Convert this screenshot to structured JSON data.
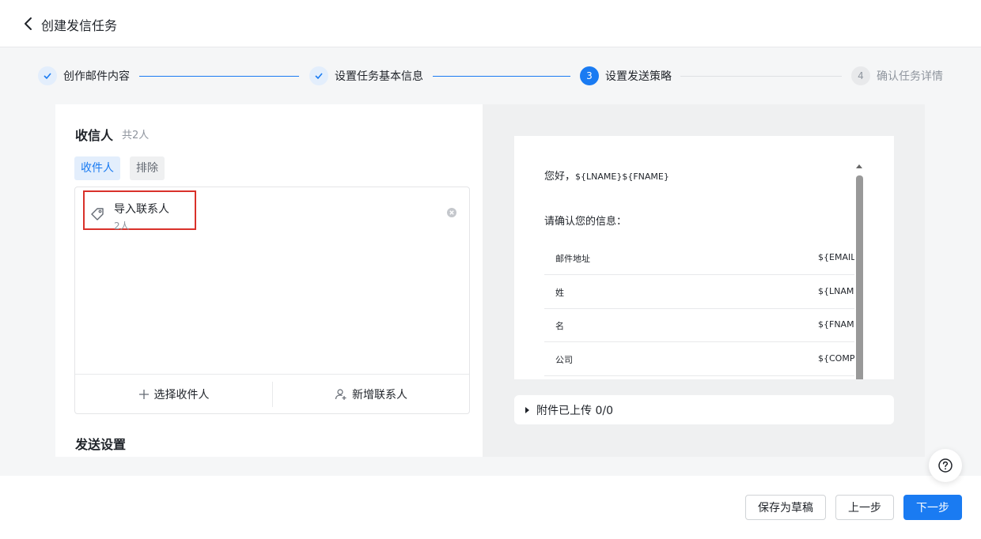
{
  "header": {
    "title": "创建发信任务"
  },
  "steps": [
    {
      "label": "创作邮件内容",
      "status": "done"
    },
    {
      "label": "设置任务基本信息",
      "status": "done"
    },
    {
      "label": "设置发送策略",
      "status": "active",
      "num": "3"
    },
    {
      "label": "确认任务详情",
      "status": "todo",
      "num": "4"
    }
  ],
  "recipients": {
    "title": "收信人",
    "count": "共2人",
    "tabs": [
      "收件人",
      "排除"
    ],
    "item": {
      "name": "导入联系人",
      "count": "2人"
    },
    "select_label": "选择收件人",
    "add_contact_label": "新增联系人"
  },
  "send_settings": {
    "title": "发送设置"
  },
  "preview": {
    "greeting": "您好，",
    "greeting_vars": "${LNAME}${FNAME}",
    "confirm": "请确认您的信息：",
    "rows": [
      {
        "label": "邮件地址",
        "value": "${EMAIL}"
      },
      {
        "label": "姓",
        "value": "${LNAME}"
      },
      {
        "label": "名",
        "value": "${FNAME}"
      },
      {
        "label": "公司",
        "value": "${COMPANY}"
      }
    ],
    "attachments": "附件已上传 0/0"
  },
  "footer": {
    "save_draft": "保存为草稿",
    "prev": "上一步",
    "next": "下一步"
  },
  "colors": {
    "accent": "#1a7bf2",
    "highlight_border": "#d9312a"
  }
}
